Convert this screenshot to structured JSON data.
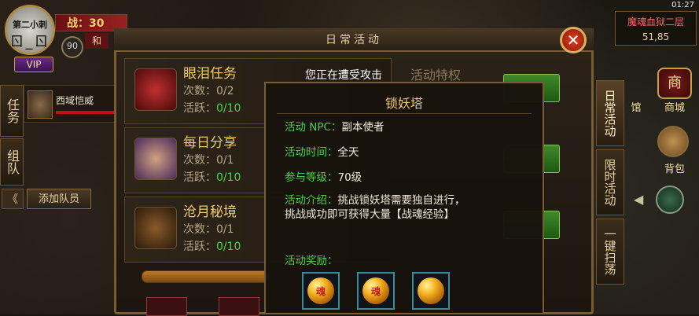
{
  "player": {
    "avatar_name": "第二小刺",
    "avatar_face": "ㄖ_ㄖ",
    "vip_label": "VIP",
    "level": "90",
    "power_label": "战：30",
    "mode": "和"
  },
  "left_tabs": {
    "quest": "任务",
    "team": "组队"
  },
  "team_member": {
    "name": "西域恺威"
  },
  "left_buttons": {
    "collapse": "《",
    "add_member": "添加队员"
  },
  "status": {
    "time": "01:27"
  },
  "map": {
    "name": "魔魂血狱二层",
    "coords": "51,85"
  },
  "right_buttons": {
    "shop": "商城",
    "shop_glyph": "商",
    "hall": "馆",
    "bag": "背包"
  },
  "right_tabs": {
    "daily": "日常活动",
    "limited": "限时活动",
    "sweep": "一键扫荡"
  },
  "panel": {
    "title": "日常活动",
    "close_glyph": "✕",
    "top_right_label": "活动特权"
  },
  "activities": [
    {
      "name": "眼泪任务",
      "count": "次数：0/2",
      "active": "活跃：0/10",
      "active_label": "活跃：",
      "active_value": "0/10",
      "count_label": "次数：",
      "count_value": "0/2"
    },
    {
      "name": "每日分享",
      "count": "次数：0/1",
      "active": "活跃：0/10",
      "active_label": "活跃：",
      "active_value": "0/10",
      "count_label": "次数：",
      "count_value": "0/1"
    },
    {
      "name": "沧月秘境",
      "count": "次数：0/1",
      "active": "活跃：0/10",
      "active_label": "活跃：",
      "active_value": "0/10",
      "count_label": "次数：",
      "count_value": "0/1"
    }
  ],
  "notice": "您正在遭受攻击",
  "popup": {
    "title": "锁妖塔",
    "npc_label": "活动 NPC：",
    "npc_value": "副本使者",
    "time_label": "活动时间：",
    "time_value": "全天",
    "level_label": "参与等级：",
    "level_value": "70级",
    "intro_label": "活动介绍：",
    "intro_line1": "挑战锁妖塔需要独自进行，",
    "intro_line2": "挑战成功即可获得大量【战魂经验】",
    "reward_label": "活动奖励：",
    "reward_glyph": "魂"
  },
  "colors": {
    "accent_gold": "#f0c870",
    "label_green": "#4cd04c",
    "frame_brown": "#7a5c32",
    "reward_border": "#3a8a9a",
    "map_name_red": "#ff6a6a"
  }
}
